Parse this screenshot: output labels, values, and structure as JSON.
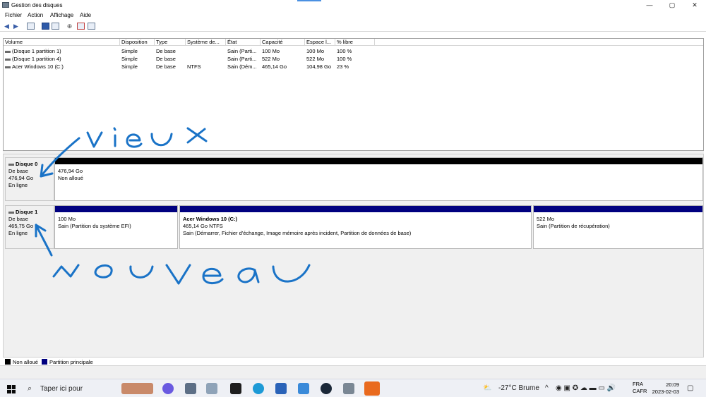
{
  "window": {
    "title": "Gestion des disques",
    "minimize": "—",
    "maximize": "▢",
    "close": "✕"
  },
  "menu": {
    "items": [
      "Fichier",
      "Action",
      "Affichage",
      "Aide"
    ]
  },
  "volumes": {
    "columns": [
      "Volume",
      "Disposition",
      "Type",
      "Système de...",
      "État",
      "Capacité",
      "Espace l...",
      "% libre"
    ],
    "rows": [
      [
        "(Disque 1 partition 1)",
        "Simple",
        "De base",
        "",
        "Sain (Parti...",
        "100 Mo",
        "100 Mo",
        "100 %"
      ],
      [
        "(Disque 1 partition 4)",
        "Simple",
        "De base",
        "",
        "Sain (Parti...",
        "522 Mo",
        "522 Mo",
        "100 %"
      ],
      [
        "Acer Windows 10 (C:)",
        "Simple",
        "De base",
        "NTFS",
        "Sain (Dém...",
        "465,14 Go",
        "104,98 Go",
        "23 %"
      ]
    ]
  },
  "disks": [
    {
      "name": "Disque 0",
      "type": "De base",
      "size": "476,94 Go",
      "status": "En ligne",
      "partitions": [
        {
          "name": "",
          "size": "476,94 Go",
          "desc": "Non alloué",
          "bar_color": "#000000"
        }
      ]
    },
    {
      "name": "Disque 1",
      "type": "De base",
      "size": "465,75 Go",
      "status": "En ligne",
      "partitions": [
        {
          "name": "",
          "size": "100 Mo",
          "desc": "Sain (Partition du système EFI)",
          "bar_color": "#00007f"
        },
        {
          "name": "Acer Windows 10  (C:)",
          "size": "465,14 Go NTFS",
          "desc": "Sain (Démarrer, Fichier d'échange, Image mémoire après incident, Partition de données de base)",
          "bar_color": "#00007f"
        },
        {
          "name": "",
          "size": "522 Mo",
          "desc": "Sain (Partition de récupération)",
          "bar_color": "#00007f"
        }
      ]
    }
  ],
  "legend": [
    {
      "label": "Non alloué",
      "color": "#000000"
    },
    {
      "label": "Partition principale",
      "color": "#00007f"
    }
  ],
  "annotations": {
    "top": "vieux",
    "bottom": "nouveau",
    "ink_color": "#1a73c7"
  },
  "taskbar": {
    "search_placeholder": "Taper ici pour",
    "weather": "-27°C  Brume",
    "language": "FRA",
    "layout": "CAFR",
    "time": "20:09",
    "date": "2023-02-03"
  }
}
